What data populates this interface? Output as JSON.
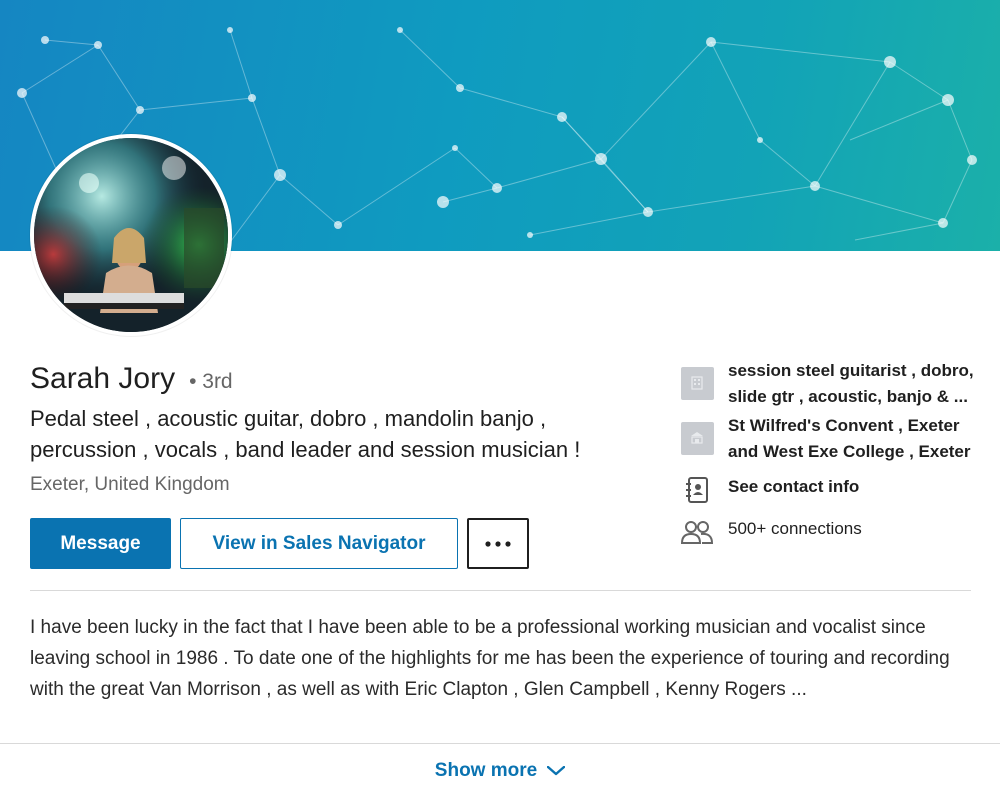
{
  "profile": {
    "name": "Sarah Jory",
    "degree": "• 3rd",
    "headline": "Pedal steel , acoustic guitar, dobro , mandolin banjo , percussion , vocals , band leader and session musician !",
    "location": "Exeter, United Kingdom"
  },
  "actions": {
    "message_label": "Message",
    "sales_label": "View in Sales Navigator",
    "more_label": "···"
  },
  "side": {
    "current_position": "session steel guitarist , dobro, slide gtr , acoustic, banjo & ...",
    "education": "St Wilfred's Convent , Exeter and West Exe College , Exeter",
    "contact_info": "See contact info",
    "connections": "500+ connections"
  },
  "summary": {
    "text": "I have been lucky in the fact that I have been able to be a professional working musician and vocalist since leaving school in 1986 . To date one of the highlights for me has been the experience of touring and recording with the great Van Morrison , as well as with Eric Clapton , Glen Campbell , Kenny Rogers ..."
  },
  "footer": {
    "show_more_label": "Show more"
  },
  "colors": {
    "accent": "#0a73b1",
    "banner_start": "#1586c2",
    "banner_end": "#1bb0a9"
  },
  "icons": {
    "company": "building-logo-icon",
    "school": "school-logo-icon",
    "contact": "address-book-icon",
    "connections": "people-icon",
    "show_more": "chevron-down-icon"
  }
}
